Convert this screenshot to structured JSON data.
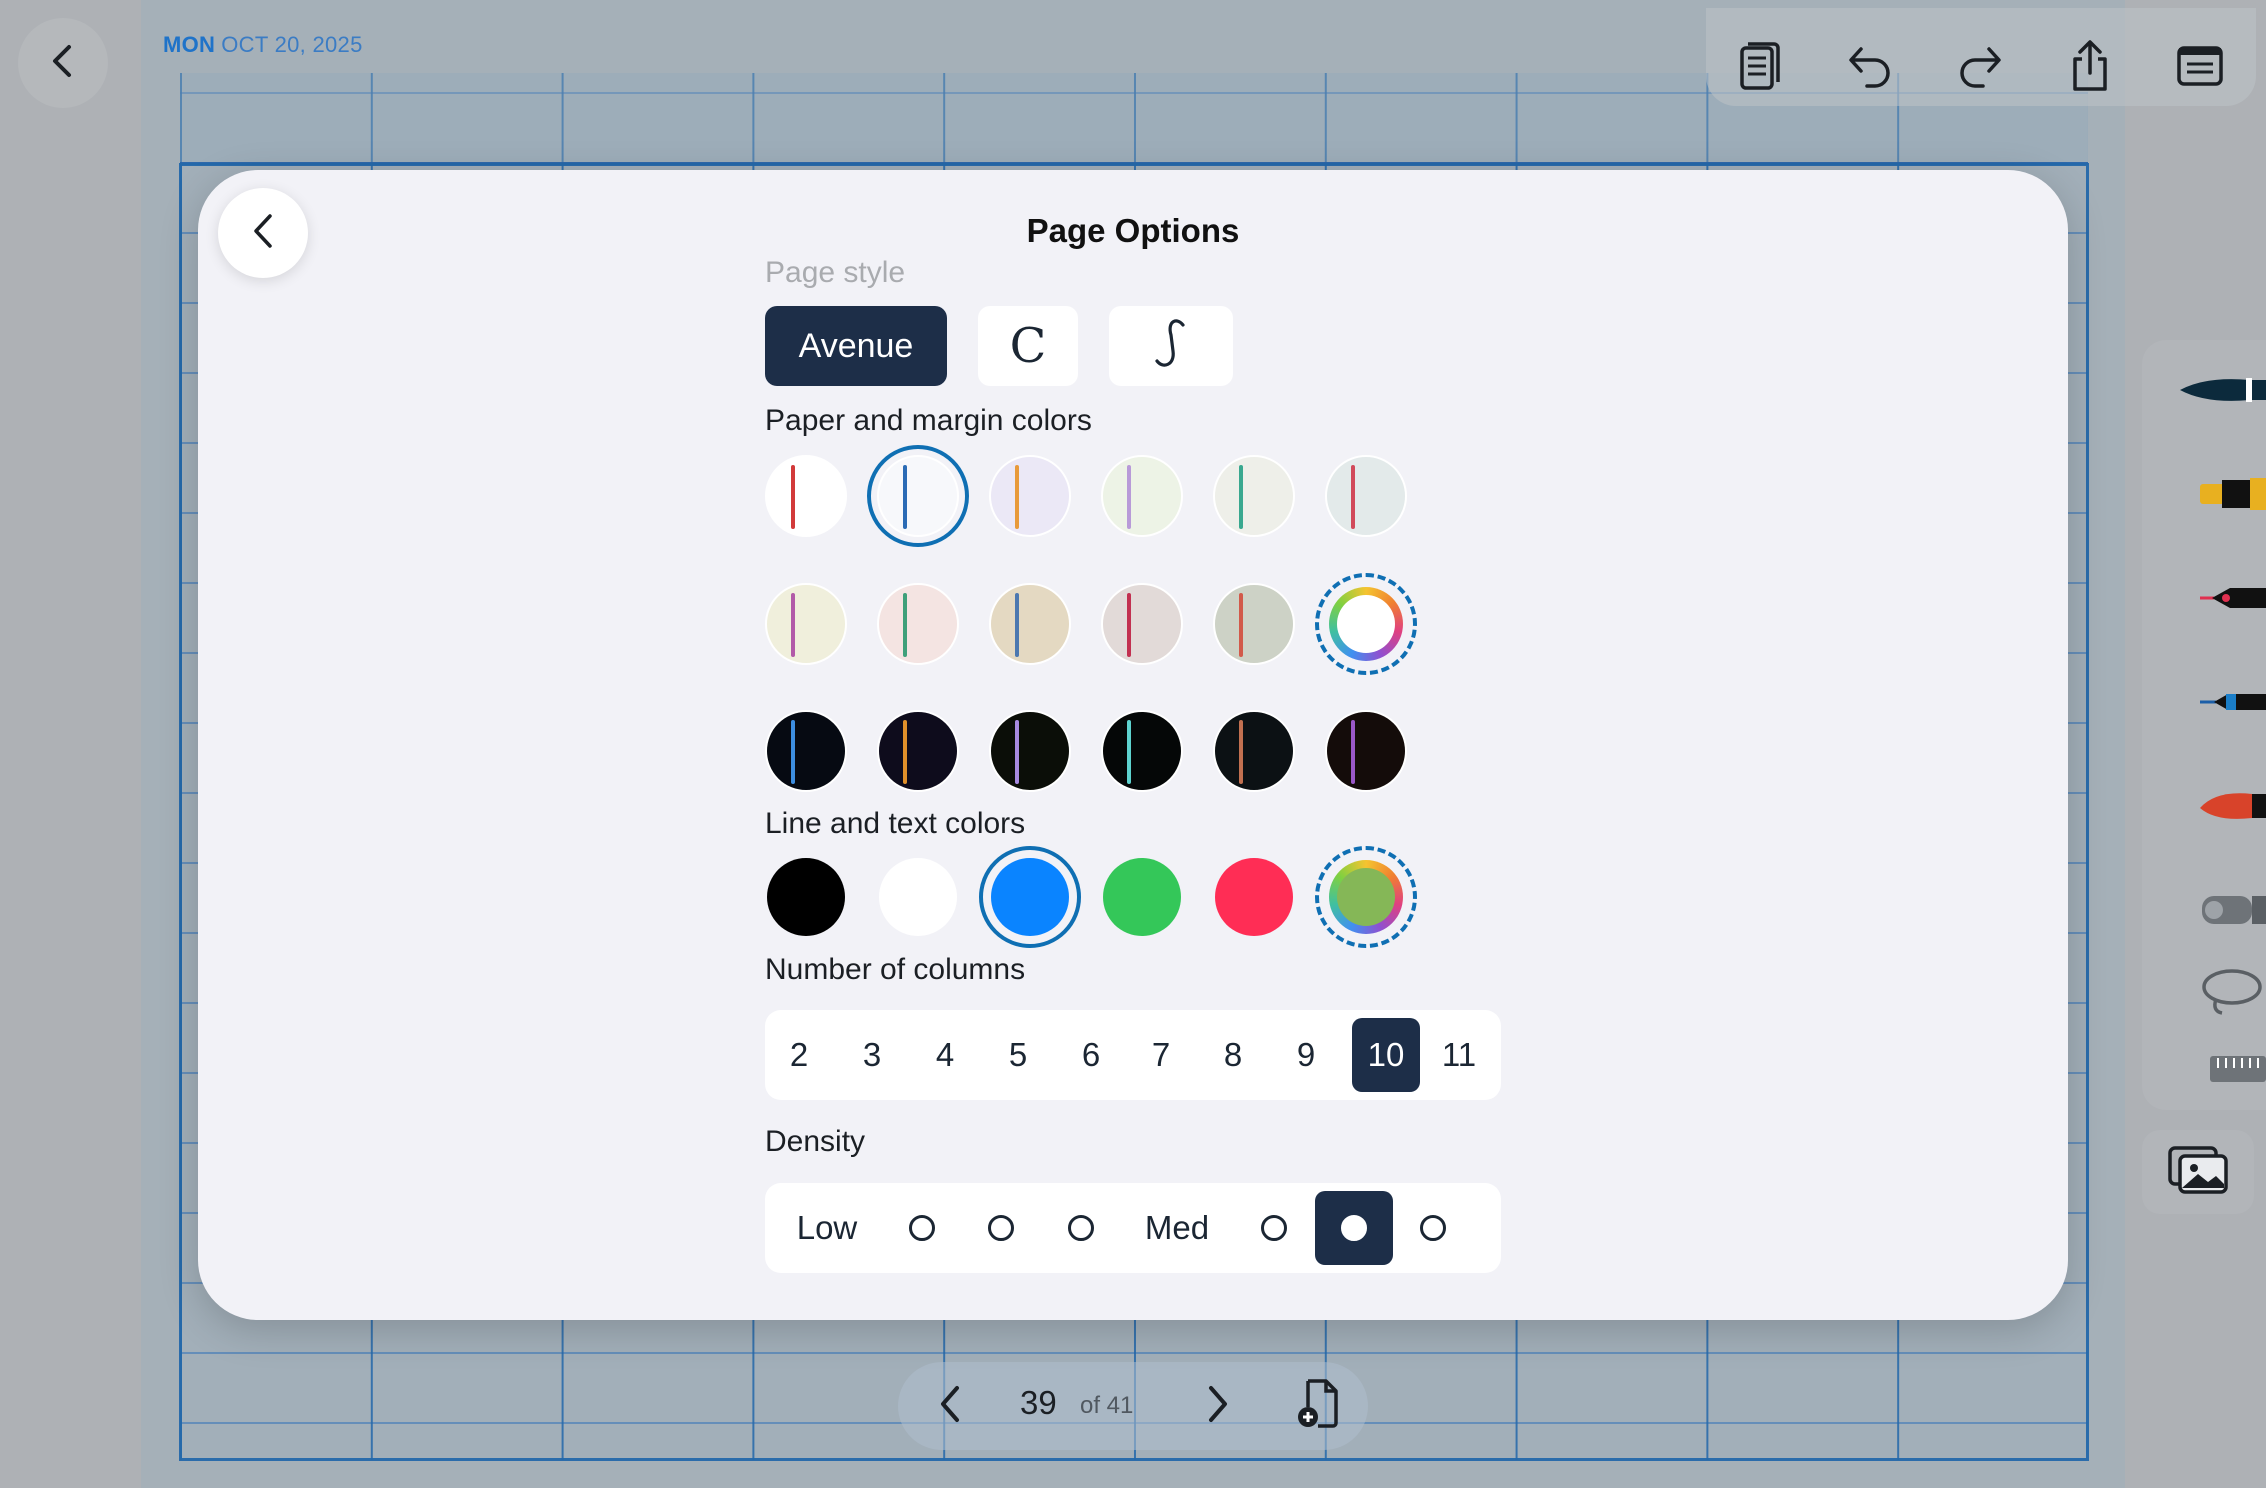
{
  "header": {
    "date_day": "MON",
    "date_rest": "OCT 20, 2025",
    "toolbar": [
      "pages-icon",
      "undo-icon",
      "redo-icon",
      "share-icon",
      "notes-icon"
    ]
  },
  "modal": {
    "title": "Page Options",
    "page_style": {
      "label": "Page style",
      "options": [
        "Avenue",
        "C",
        "S"
      ],
      "selected": "Avenue"
    },
    "paper_colors": {
      "label": "Paper and margin colors",
      "rows": [
        [
          {
            "bg": "#ffffff",
            "line": "#d23a3a"
          },
          {
            "bg": "#f7f8fb",
            "line": "#2b6bb5",
            "selected": true
          },
          {
            "bg": "#ebe8f6",
            "line": "#e89a3a"
          },
          {
            "bg": "#edf3e6",
            "line": "#b89ad8"
          },
          {
            "bg": "#eeefe9",
            "line": "#39a88f"
          },
          {
            "bg": "#e3eaea",
            "line": "#d14a5a"
          }
        ],
        [
          {
            "bg": "#f0efdc",
            "line": "#b25aa8"
          },
          {
            "bg": "#f4e4e2",
            "line": "#3fa07a"
          },
          {
            "bg": "#e4d9c2",
            "line": "#4c78b0"
          },
          {
            "bg": "#e2dad8",
            "line": "#c23050"
          },
          {
            "bg": "#cdd2c6",
            "line": "#d25a4a"
          },
          {
            "custom": true
          }
        ],
        [
          {
            "bg": "#060a12",
            "line": "#3d8ee0"
          },
          {
            "bg": "#0e0c1c",
            "line": "#e0902a"
          },
          {
            "bg": "#0b0e08",
            "line": "#a78ae0"
          },
          {
            "bg": "#050707",
            "line": "#5ed3cf"
          },
          {
            "bg": "#0c1114",
            "line": "#c27050"
          },
          {
            "bg": "#140c0a",
            "line": "#9a58c8"
          }
        ]
      ]
    },
    "line_colors": {
      "label": "Line and text colors",
      "swatches": [
        {
          "color": "#000000"
        },
        {
          "color": "#ffffff"
        },
        {
          "color": "#0a84ff",
          "selected": true
        },
        {
          "color": "#34c759"
        },
        {
          "color": "#ff2d55"
        },
        {
          "color": "#85b757",
          "custom": true
        }
      ]
    },
    "columns": {
      "label": "Number of columns",
      "options": [
        "2",
        "3",
        "4",
        "5",
        "6",
        "7",
        "8",
        "9",
        "10",
        "11"
      ],
      "selected": "10"
    },
    "density": {
      "label": "Density",
      "low": "Low",
      "med": "Med",
      "selected_index": 6
    }
  },
  "pager": {
    "current": "39",
    "total": "of 41"
  }
}
